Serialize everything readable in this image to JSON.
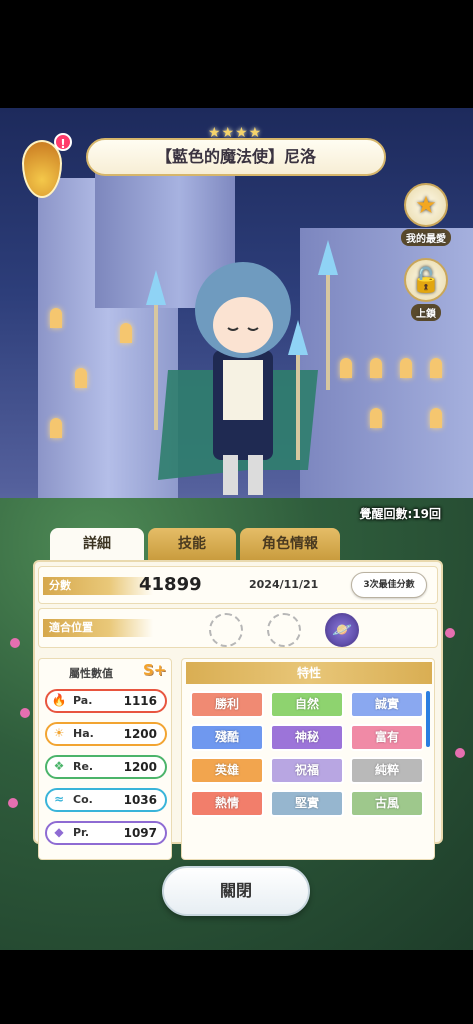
{
  "header": {
    "stars": "★★★★",
    "title": "【藍色的魔法使】尼洛",
    "alert": "!"
  },
  "side": {
    "favorite_label": "我的最愛",
    "favorite_icon": "star-icon",
    "lock_label": "上鎖",
    "lock_icon": "unlock-icon"
  },
  "awaken_text": "覺醒回數:19回",
  "tabs": [
    "詳細",
    "技能",
    "角色情報"
  ],
  "score": {
    "label": "分數",
    "value": "41899",
    "date": "2024/11/21",
    "best_button": "3次最佳分數"
  },
  "position": {
    "label": "適合位置"
  },
  "stats": {
    "title": "屬性數值",
    "rank": "S+",
    "items": [
      {
        "name": "Pa.",
        "value": "1116",
        "color": "#e8553f",
        "icon": "flame-icon"
      },
      {
        "name": "Ha.",
        "value": "1200",
        "color": "#f2a431",
        "icon": "sun-icon"
      },
      {
        "name": "Re.",
        "value": "1200",
        "color": "#4bb46a",
        "icon": "clover-icon"
      },
      {
        "name": "Co.",
        "value": "1036",
        "color": "#39b4d9",
        "icon": "wave-icon"
      },
      {
        "name": "Pr.",
        "value": "1097",
        "color": "#8e6bd3",
        "icon": "gem-icon"
      }
    ]
  },
  "traits": {
    "title": "特性",
    "items": [
      {
        "label": "勝利",
        "color": "#f08a73"
      },
      {
        "label": "自然",
        "color": "#8ed36f"
      },
      {
        "label": "誠實",
        "color": "#8aa8f0"
      },
      {
        "label": "殘酷",
        "color": "#6f98ef"
      },
      {
        "label": "神秘",
        "color": "#9c74d9"
      },
      {
        "label": "富有",
        "color": "#f08aa6"
      },
      {
        "label": "英雄",
        "color": "#f2a54e"
      },
      {
        "label": "祝福",
        "color": "#b8a6e2"
      },
      {
        "label": "純粹",
        "color": "#b9b9b9"
      },
      {
        "label": "熱情",
        "color": "#f27e6b"
      },
      {
        "label": "堅實",
        "color": "#96b6cf"
      },
      {
        "label": "古風",
        "color": "#9ec88c"
      }
    ]
  },
  "close_button": "關閉"
}
